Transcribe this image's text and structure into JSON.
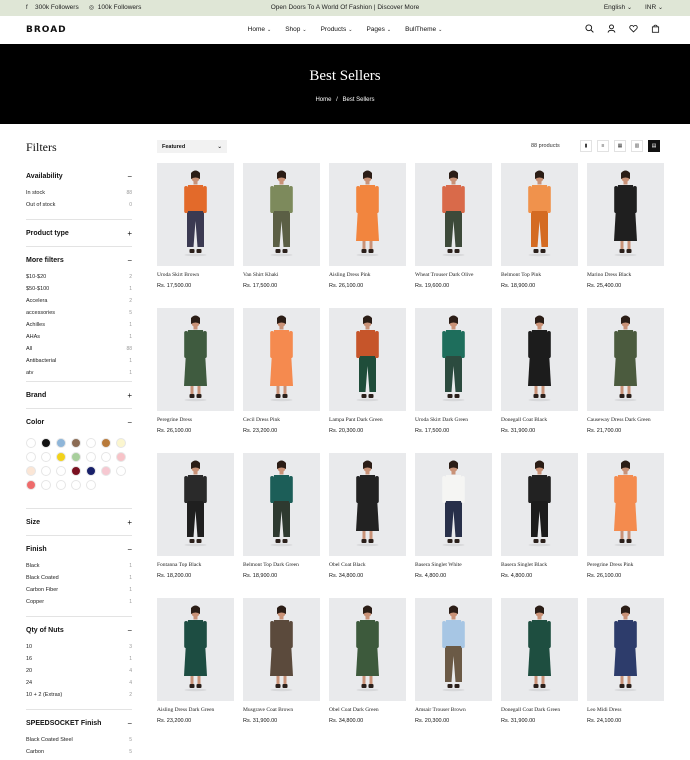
{
  "topbar": {
    "facebook": "300k Followers",
    "instagram": "100k Followers",
    "announcement": "Open Doors To A World Of Fashion | Discover More",
    "language": "English",
    "currency": "INR"
  },
  "header": {
    "logo": "BROAD",
    "nav": [
      "Home",
      "Shop",
      "Products",
      "Pages",
      "BullTheme"
    ]
  },
  "hero": {
    "title": "Best Sellers",
    "breadcrumb_home": "Home",
    "breadcrumb_sep": "/",
    "breadcrumb_current": "Best Sellers"
  },
  "filters": {
    "title": "Filters",
    "availability": {
      "label": "Availability",
      "items": [
        {
          "label": "In stock",
          "count": "88"
        },
        {
          "label": "Out of stock",
          "count": "0"
        }
      ]
    },
    "product_type": {
      "label": "Product type"
    },
    "more_filters": {
      "label": "More filters",
      "items": [
        {
          "label": "$10-$20",
          "count": "2"
        },
        {
          "label": "$50-$100",
          "count": "1"
        },
        {
          "label": "Accelera",
          "count": "2"
        },
        {
          "label": "accessories",
          "count": "5"
        },
        {
          "label": "Achilles",
          "count": "1"
        },
        {
          "label": "AHAs",
          "count": "1"
        },
        {
          "label": "All",
          "count": "88"
        },
        {
          "label": "Antibacterial",
          "count": "1"
        },
        {
          "label": "atv",
          "count": "1"
        }
      ]
    },
    "brand": {
      "label": "Brand"
    },
    "color": {
      "label": "Color",
      "swatches": [
        "#ffffff",
        "#111111",
        "#8fb6d9",
        "#8b6b53",
        "#ffffff",
        "#b87a3a",
        "#fbf6cf",
        "#ffffff",
        "#ffffff",
        "#f2d21a",
        "#a8cf9c",
        "#ffffff",
        "#ffffff",
        "#f7c3c8",
        "#fbe6d6",
        "#ffffff",
        "#ffffff",
        "#7a1020",
        "#18206a",
        "#f6c8d1",
        "#ffffff",
        "#ee6b6b",
        "#ffffff",
        "#ffffff",
        "#ffffff",
        "#ffffff"
      ]
    },
    "size": {
      "label": "Size"
    },
    "finish": {
      "label": "Finish",
      "items": [
        {
          "label": "Black",
          "count": "1"
        },
        {
          "label": "Black Coated",
          "count": "1"
        },
        {
          "label": "Carbon Fiber",
          "count": "1"
        },
        {
          "label": "Copper",
          "count": "1"
        }
      ]
    },
    "nuts": {
      "label": "Qty of Nuts",
      "items": [
        {
          "label": "10",
          "count": "3"
        },
        {
          "label": "16",
          "count": "1"
        },
        {
          "label": "20",
          "count": "4"
        },
        {
          "label": "24",
          "count": "4"
        },
        {
          "label": "10 + 2 (Extras)",
          "count": "2"
        }
      ]
    },
    "speedsocket": {
      "label": "SPEEDSOCKET Finish",
      "items": [
        {
          "label": "Black Coated Steel",
          "count": "5"
        },
        {
          "label": "Carbon",
          "count": "5"
        }
      ]
    }
  },
  "toolbar": {
    "sort": "Featured",
    "count": "88 products"
  },
  "products": [
    {
      "name": "Uroda Skirt Brown",
      "price": "Rs. 17,500.00",
      "top": "#e36a2a",
      "bottom": "#3b3a52",
      "skin": "#c99277"
    },
    {
      "name": "Van Shirt Khaki",
      "price": "Rs. 17,500.00",
      "top": "#7d8a5c",
      "bottom": "#5b5f45",
      "skin": "#c99277"
    },
    {
      "name": "Aisling Dress Pink",
      "price": "Rs. 26,100.00",
      "top": "#f2853e",
      "bottom": "#f2853e",
      "skin": "#c99277"
    },
    {
      "name": "Wheat Trouser Dark Olive",
      "price": "Rs. 19,600.00",
      "top": "#d96a4a",
      "bottom": "#3d4a3a",
      "skin": "#c99277"
    },
    {
      "name": "Belmont Top Pink",
      "price": "Rs. 18,900.00",
      "top": "#f0924c",
      "bottom": "#d46b22",
      "skin": "#c99277"
    },
    {
      "name": "Marino Dress Black",
      "price": "Rs. 25,400.00",
      "top": "#1f1f1f",
      "bottom": "#1f1f1f",
      "skin": "#c99277"
    },
    {
      "name": "Peregrine Dress",
      "price": "Rs. 26,100.00",
      "top": "#3f5b3f",
      "bottom": "#3f5b3f",
      "skin": "#c99277"
    },
    {
      "name": "Cecil Dress Pink",
      "price": "Rs. 23,200.00",
      "top": "#f58a4f",
      "bottom": "#f58a4f",
      "skin": "#c99277"
    },
    {
      "name": "Lampa Pant Dark Green",
      "price": "Rs. 20,300.00",
      "top": "#c6552a",
      "bottom": "#1f4d3a",
      "skin": "#c99277"
    },
    {
      "name": "Uroda Skirt Dark Green",
      "price": "Rs. 17,500.00",
      "top": "#1e6e5c",
      "bottom": "#2c4b3f",
      "skin": "#c99277"
    },
    {
      "name": "Donegall Coat Black",
      "price": "Rs. 31,900.00",
      "top": "#1c1c1c",
      "bottom": "#1c1c1c",
      "skin": "#c99277"
    },
    {
      "name": "Causeway Dress Dark Green",
      "price": "Rs. 21,700.00",
      "top": "#4b5b3e",
      "bottom": "#4b5b3e",
      "skin": "#c99277"
    },
    {
      "name": "Fontanna Top Black",
      "price": "Rs. 18,200.00",
      "top": "#2a2a2a",
      "bottom": "#1f1f1f",
      "skin": "#c99277"
    },
    {
      "name": "Belmont Top Dark Green",
      "price": "Rs. 18,900.00",
      "top": "#1c5e58",
      "bottom": "#2e3a30",
      "skin": "#c99277"
    },
    {
      "name": "Obel Coat Black",
      "price": "Rs. 34,800.00",
      "top": "#222222",
      "bottom": "#222222",
      "skin": "#c99277"
    },
    {
      "name": "Basera Singlet White",
      "price": "Rs. 4,800.00",
      "top": "#f5f5f3",
      "bottom": "#28304a",
      "skin": "#c99277"
    },
    {
      "name": "Basera Singlet Black",
      "price": "Rs. 4,800.00",
      "top": "#222222",
      "bottom": "#1c1c1c",
      "skin": "#c99277"
    },
    {
      "name": "Peregrine Dress Pink",
      "price": "Rs. 26,100.00",
      "top": "#f48b4e",
      "bottom": "#f48b4e",
      "skin": "#c99277"
    },
    {
      "name": "Aisling Dress Dark Green",
      "price": "Rs. 23,200.00",
      "top": "#1d4d42",
      "bottom": "#1d4d42",
      "skin": "#c99277"
    },
    {
      "name": "Musgrave Coat Brown",
      "price": "Rs. 31,900.00",
      "top": "#5b4a3c",
      "bottom": "#5b4a3c",
      "skin": "#c99277"
    },
    {
      "name": "Obel Coat Dark Green",
      "price": "Rs. 34,800.00",
      "top": "#3d5a3c",
      "bottom": "#3d5a3c",
      "skin": "#c99277"
    },
    {
      "name": "Amsair Trouser Brown",
      "price": "Rs. 20,300.00",
      "top": "#a7c6e4",
      "bottom": "#6b5a46",
      "skin": "#c99277"
    },
    {
      "name": "Donegall Coat Dark Green",
      "price": "Rs. 31,900.00",
      "top": "#1e4e40",
      "bottom": "#1e4e40",
      "skin": "#c99277"
    },
    {
      "name": "Leo Midi Dress",
      "price": "Rs. 24,100.00",
      "top": "#2d3c6b",
      "bottom": "#2d3c6b",
      "skin": "#c99277"
    }
  ]
}
